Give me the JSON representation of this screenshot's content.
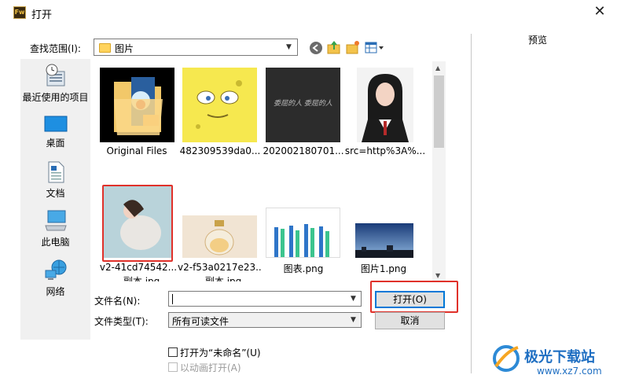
{
  "window": {
    "title": "打开",
    "app_icon_text": "Fw"
  },
  "lookin": {
    "label": "查找范围(I):",
    "value": "图片"
  },
  "preview": {
    "label": "预览"
  },
  "places": [
    {
      "label": "最近使用的项目"
    },
    {
      "label": "桌面"
    },
    {
      "label": "文档"
    },
    {
      "label": "此电脑"
    },
    {
      "label": "网络"
    }
  ],
  "files": [
    {
      "name": "Original Files",
      "name2": ""
    },
    {
      "name": "482309539da0...",
      "name2": ""
    },
    {
      "name": "202002180701...",
      "name2": ""
    },
    {
      "name": "src=http%3A%...",
      "name2": ""
    },
    {
      "name": "v2-41cd74542...",
      "name2": "- 副本.jpg"
    },
    {
      "name": "v2-f53a0217e23...",
      "name2": "- 副本.jpg"
    },
    {
      "name": "图表.png",
      "name2": ""
    },
    {
      "name": "图片1.png",
      "name2": ""
    }
  ],
  "thumb_text": {
    "handwriting": "委屈的人 委屈的人"
  },
  "filename": {
    "label": "文件名(N):",
    "value": ""
  },
  "filetype": {
    "label": "文件类型(T):",
    "value": "所有可读文件"
  },
  "buttons": {
    "open": "打开(O)",
    "cancel": "取消"
  },
  "options": {
    "open_untitled": "打开为“未命名”(U)",
    "animation": "以动画打开(A)"
  },
  "watermark": {
    "title": "极光下载站",
    "url": "www.xz7.com"
  },
  "colors": {
    "highlight": "#e0312a",
    "accent_button_border": "#0078d7"
  }
}
